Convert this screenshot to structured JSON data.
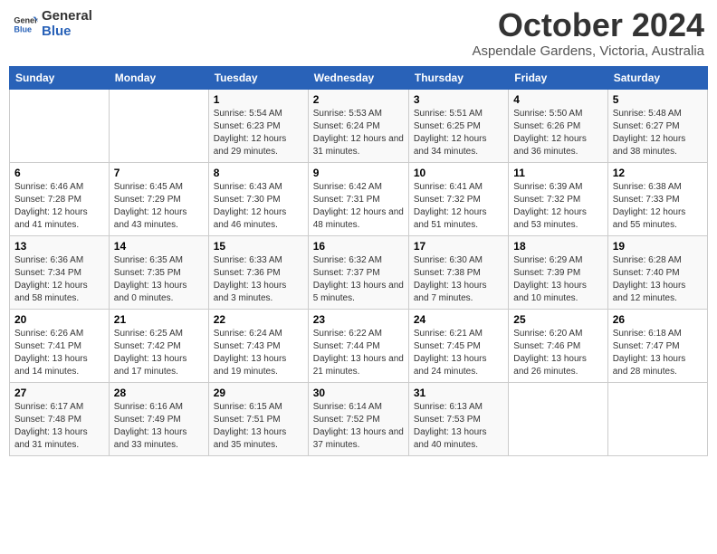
{
  "header": {
    "logo_line1": "General",
    "logo_line2": "Blue",
    "month": "October 2024",
    "location": "Aspendale Gardens, Victoria, Australia"
  },
  "weekdays": [
    "Sunday",
    "Monday",
    "Tuesday",
    "Wednesday",
    "Thursday",
    "Friday",
    "Saturday"
  ],
  "weeks": [
    [
      {
        "day": "",
        "sunrise": "",
        "sunset": "",
        "daylight": ""
      },
      {
        "day": "",
        "sunrise": "",
        "sunset": "",
        "daylight": ""
      },
      {
        "day": "1",
        "sunrise": "Sunrise: 5:54 AM",
        "sunset": "Sunset: 6:23 PM",
        "daylight": "Daylight: 12 hours and 29 minutes."
      },
      {
        "day": "2",
        "sunrise": "Sunrise: 5:53 AM",
        "sunset": "Sunset: 6:24 PM",
        "daylight": "Daylight: 12 hours and 31 minutes."
      },
      {
        "day": "3",
        "sunrise": "Sunrise: 5:51 AM",
        "sunset": "Sunset: 6:25 PM",
        "daylight": "Daylight: 12 hours and 34 minutes."
      },
      {
        "day": "4",
        "sunrise": "Sunrise: 5:50 AM",
        "sunset": "Sunset: 6:26 PM",
        "daylight": "Daylight: 12 hours and 36 minutes."
      },
      {
        "day": "5",
        "sunrise": "Sunrise: 5:48 AM",
        "sunset": "Sunset: 6:27 PM",
        "daylight": "Daylight: 12 hours and 38 minutes."
      }
    ],
    [
      {
        "day": "6",
        "sunrise": "Sunrise: 6:46 AM",
        "sunset": "Sunset: 7:28 PM",
        "daylight": "Daylight: 12 hours and 41 minutes."
      },
      {
        "day": "7",
        "sunrise": "Sunrise: 6:45 AM",
        "sunset": "Sunset: 7:29 PM",
        "daylight": "Daylight: 12 hours and 43 minutes."
      },
      {
        "day": "8",
        "sunrise": "Sunrise: 6:43 AM",
        "sunset": "Sunset: 7:30 PM",
        "daylight": "Daylight: 12 hours and 46 minutes."
      },
      {
        "day": "9",
        "sunrise": "Sunrise: 6:42 AM",
        "sunset": "Sunset: 7:31 PM",
        "daylight": "Daylight: 12 hours and 48 minutes."
      },
      {
        "day": "10",
        "sunrise": "Sunrise: 6:41 AM",
        "sunset": "Sunset: 7:32 PM",
        "daylight": "Daylight: 12 hours and 51 minutes."
      },
      {
        "day": "11",
        "sunrise": "Sunrise: 6:39 AM",
        "sunset": "Sunset: 7:32 PM",
        "daylight": "Daylight: 12 hours and 53 minutes."
      },
      {
        "day": "12",
        "sunrise": "Sunrise: 6:38 AM",
        "sunset": "Sunset: 7:33 PM",
        "daylight": "Daylight: 12 hours and 55 minutes."
      }
    ],
    [
      {
        "day": "13",
        "sunrise": "Sunrise: 6:36 AM",
        "sunset": "Sunset: 7:34 PM",
        "daylight": "Daylight: 12 hours and 58 minutes."
      },
      {
        "day": "14",
        "sunrise": "Sunrise: 6:35 AM",
        "sunset": "Sunset: 7:35 PM",
        "daylight": "Daylight: 13 hours and 0 minutes."
      },
      {
        "day": "15",
        "sunrise": "Sunrise: 6:33 AM",
        "sunset": "Sunset: 7:36 PM",
        "daylight": "Daylight: 13 hours and 3 minutes."
      },
      {
        "day": "16",
        "sunrise": "Sunrise: 6:32 AM",
        "sunset": "Sunset: 7:37 PM",
        "daylight": "Daylight: 13 hours and 5 minutes."
      },
      {
        "day": "17",
        "sunrise": "Sunrise: 6:30 AM",
        "sunset": "Sunset: 7:38 PM",
        "daylight": "Daylight: 13 hours and 7 minutes."
      },
      {
        "day": "18",
        "sunrise": "Sunrise: 6:29 AM",
        "sunset": "Sunset: 7:39 PM",
        "daylight": "Daylight: 13 hours and 10 minutes."
      },
      {
        "day": "19",
        "sunrise": "Sunrise: 6:28 AM",
        "sunset": "Sunset: 7:40 PM",
        "daylight": "Daylight: 13 hours and 12 minutes."
      }
    ],
    [
      {
        "day": "20",
        "sunrise": "Sunrise: 6:26 AM",
        "sunset": "Sunset: 7:41 PM",
        "daylight": "Daylight: 13 hours and 14 minutes."
      },
      {
        "day": "21",
        "sunrise": "Sunrise: 6:25 AM",
        "sunset": "Sunset: 7:42 PM",
        "daylight": "Daylight: 13 hours and 17 minutes."
      },
      {
        "day": "22",
        "sunrise": "Sunrise: 6:24 AM",
        "sunset": "Sunset: 7:43 PM",
        "daylight": "Daylight: 13 hours and 19 minutes."
      },
      {
        "day": "23",
        "sunrise": "Sunrise: 6:22 AM",
        "sunset": "Sunset: 7:44 PM",
        "daylight": "Daylight: 13 hours and 21 minutes."
      },
      {
        "day": "24",
        "sunrise": "Sunrise: 6:21 AM",
        "sunset": "Sunset: 7:45 PM",
        "daylight": "Daylight: 13 hours and 24 minutes."
      },
      {
        "day": "25",
        "sunrise": "Sunrise: 6:20 AM",
        "sunset": "Sunset: 7:46 PM",
        "daylight": "Daylight: 13 hours and 26 minutes."
      },
      {
        "day": "26",
        "sunrise": "Sunrise: 6:18 AM",
        "sunset": "Sunset: 7:47 PM",
        "daylight": "Daylight: 13 hours and 28 minutes."
      }
    ],
    [
      {
        "day": "27",
        "sunrise": "Sunrise: 6:17 AM",
        "sunset": "Sunset: 7:48 PM",
        "daylight": "Daylight: 13 hours and 31 minutes."
      },
      {
        "day": "28",
        "sunrise": "Sunrise: 6:16 AM",
        "sunset": "Sunset: 7:49 PM",
        "daylight": "Daylight: 13 hours and 33 minutes."
      },
      {
        "day": "29",
        "sunrise": "Sunrise: 6:15 AM",
        "sunset": "Sunset: 7:51 PM",
        "daylight": "Daylight: 13 hours and 35 minutes."
      },
      {
        "day": "30",
        "sunrise": "Sunrise: 6:14 AM",
        "sunset": "Sunset: 7:52 PM",
        "daylight": "Daylight: 13 hours and 37 minutes."
      },
      {
        "day": "31",
        "sunrise": "Sunrise: 6:13 AM",
        "sunset": "Sunset: 7:53 PM",
        "daylight": "Daylight: 13 hours and 40 minutes."
      },
      {
        "day": "",
        "sunrise": "",
        "sunset": "",
        "daylight": ""
      },
      {
        "day": "",
        "sunrise": "",
        "sunset": "",
        "daylight": ""
      }
    ]
  ]
}
